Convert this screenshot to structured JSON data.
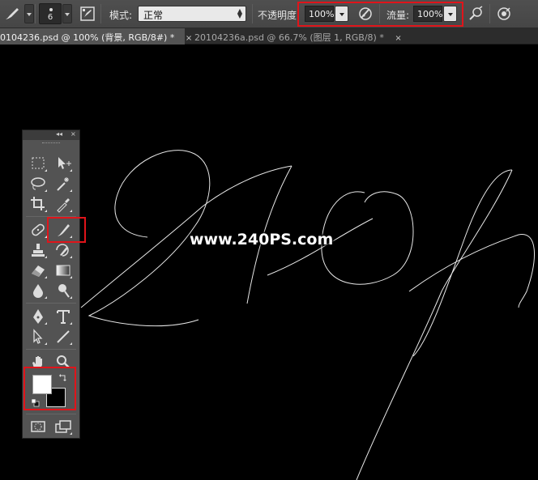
{
  "options_bar": {
    "brush_size": "6",
    "mode_label": "模式:",
    "mode_value": "正常",
    "opacity_label": "不透明度:",
    "opacity_value": "100%",
    "flow_label": "流量:",
    "flow_value": "100%",
    "icons": [
      "brush-tool-icon",
      "brush-panel-icon",
      "pressure-opacity-icon",
      "airbrush-icon",
      "pressure-size-icon"
    ]
  },
  "tabs": [
    {
      "label": "0104236.psd @ 100% (背景, RGB/8#) *",
      "close": "×",
      "active": true
    },
    {
      "label": "20104236a.psd @ 66.7% (图层 1, RGB/8) *",
      "close": "×",
      "active": false
    }
  ],
  "toolbox": {
    "header_collapse": "◂◂",
    "header_close": "×",
    "tools": [
      "marquee-tool",
      "move-tool",
      "lasso-tool",
      "magic-wand-tool",
      "crop-tool",
      "eyedropper-tool",
      "healing-brush-tool",
      "brush-tool",
      "clone-stamp-tool",
      "history-brush-tool",
      "eraser-tool",
      "gradient-tool",
      "blur-tool",
      "dodge-tool",
      "pen-tool",
      "type-tool",
      "path-selection-tool",
      "line-tool",
      "hand-tool",
      "zoom-tool"
    ],
    "foreground_color": "#ffffff",
    "background_color": "#000000"
  },
  "canvas": {
    "background": "#000000",
    "watermark": "www.240PS.com"
  },
  "highlight_color": "#e0141a"
}
